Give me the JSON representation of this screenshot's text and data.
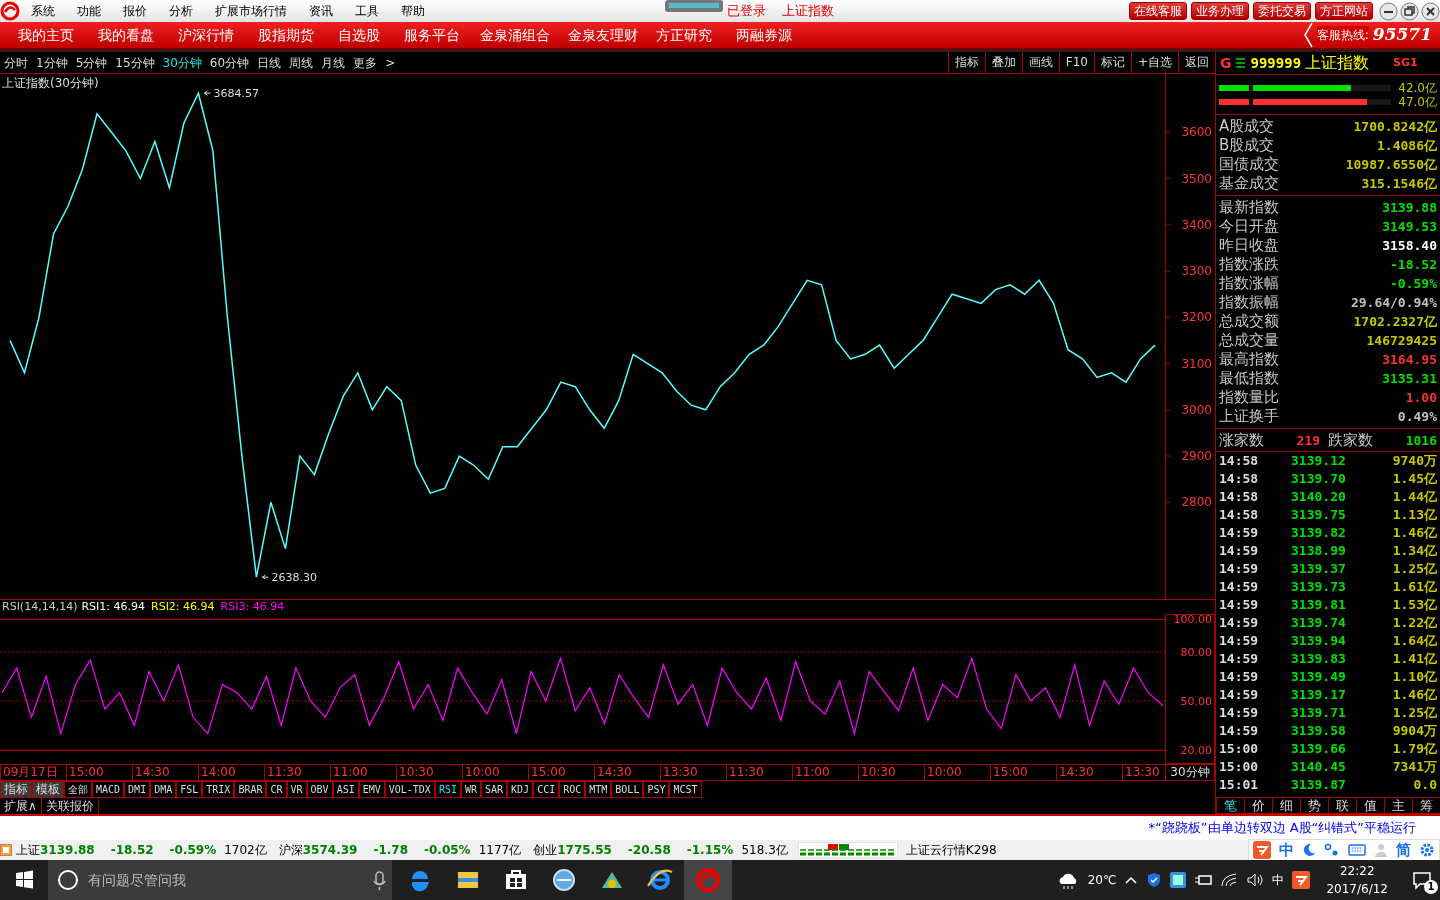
{
  "title_bar": {
    "menu": [
      "系统",
      "功能",
      "报价",
      "分析",
      "扩展市场行情",
      "资讯",
      "工具",
      "帮助"
    ],
    "login_status": "已登录",
    "security": "上证指数",
    "buttons": [
      "在线客服",
      "业务办理",
      "委托交易",
      "方正网站"
    ]
  },
  "nav": {
    "items": [
      "我的主页",
      "我的看盘",
      "沪深行情",
      "股指期货",
      "自选股",
      "服务平台",
      "金泉涌组合",
      "金泉友理财",
      "方正研究",
      "两融券源"
    ],
    "hotline_label": "客服热线:",
    "hotline": "95571"
  },
  "periods": [
    {
      "label": "分时",
      "selected": false
    },
    {
      "label": "1分钟",
      "selected": false
    },
    {
      "label": "5分钟",
      "selected": false
    },
    {
      "label": "15分钟",
      "selected": false
    },
    {
      "label": "30分钟",
      "selected": true
    },
    {
      "label": "60分钟",
      "selected": false
    },
    {
      "label": "日线",
      "selected": false
    },
    {
      "label": "周线",
      "selected": false
    },
    {
      "label": "月线",
      "selected": false
    }
  ],
  "more": "更多",
  "more_arrow": ">",
  "tools": [
    "指标",
    "叠加",
    "画线",
    "F10",
    "标记",
    "+自选",
    "返回"
  ],
  "chart_title": "上证指数(30分钟)",
  "price_chart": {
    "chart_data": {
      "type": "line",
      "ylim": [
        2591,
        3726
      ],
      "yticks": [
        2800,
        2900,
        3000,
        3100,
        3200,
        3300,
        3400,
        3500,
        3600
      ],
      "series": [
        {
          "color": "#54ffff",
          "values": [
            3150,
            3080,
            3200,
            3380,
            3440,
            3520,
            3640,
            3600,
            3560,
            3500,
            3580,
            3480,
            3620,
            3684.57,
            3560,
            3200,
            2900,
            2638.3,
            2800,
            2700,
            2900,
            2860,
            2950,
            3030,
            3080,
            3000,
            3050,
            3020,
            2880,
            2820,
            2830,
            2900,
            2880,
            2850,
            2920,
            2920,
            2960,
            3000,
            3060,
            3050,
            3000,
            2960,
            3020,
            3120,
            3100,
            3080,
            3040,
            3010,
            3000,
            3050,
            3080,
            3120,
            3140,
            3180,
            3230,
            3280,
            3270,
            3150,
            3110,
            3120,
            3140,
            3090,
            3120,
            3150,
            3200,
            3250,
            3240,
            3230,
            3260,
            3270,
            3250,
            3280,
            3230,
            3130,
            3110,
            3070,
            3080,
            3060,
            3110,
            3139.88
          ]
        }
      ],
      "annotations": [
        {
          "text": "3684.57"
        },
        {
          "text": "2638.30"
        }
      ]
    }
  },
  "rsi": {
    "label": "RSI(14,14,14)",
    "lines": [
      {
        "label": "RSI1: 46.94",
        "color": "#ffffff"
      },
      {
        "label": "RSI2: 46.94",
        "color": "#ffff00"
      },
      {
        "label": "RSI3: 46.94",
        "color": "#ff00ff"
      }
    ],
    "chart_data": {
      "type": "line",
      "grid": true,
      "ylim": [
        20,
        100
      ],
      "yticks": [
        {
          "value": 20,
          "label": "20.00"
        },
        {
          "value": 50,
          "label": "50.00"
        },
        {
          "value": 80,
          "label": "80.00"
        },
        {
          "value": 100,
          "label": "100.00"
        }
      ],
      "series": [
        {
          "color": "#ff00ff",
          "values": [
            55,
            70,
            40,
            65,
            30,
            60,
            75,
            45,
            55,
            35,
            68,
            50,
            72,
            40,
            30,
            60,
            55,
            45,
            65,
            35,
            70,
            50,
            40,
            58,
            66,
            35,
            52,
            74,
            45,
            60,
            38,
            70,
            55,
            42,
            63,
            30,
            68,
            50,
            76,
            44,
            58,
            36,
            66,
            52,
            40,
            72,
            48,
            60,
            35,
            70,
            55,
            45,
            64,
            38,
            74,
            50,
            42,
            62,
            30,
            68,
            56,
            44,
            70,
            38,
            60,
            52,
            76,
            45,
            33,
            66,
            50,
            58,
            40,
            72,
            35,
            62,
            48,
            70,
            55,
            47
          ]
        }
      ]
    }
  },
  "time_axis": [
    "09月17日",
    "15:00",
    "14:30",
    "14:00",
    "11:30",
    "11:00",
    "10:30",
    "10:00",
    "15:00",
    "14:30",
    "13:30",
    "11:30",
    "11:00",
    "10:30",
    "10:00",
    "15:00",
    "14:30",
    "13:30"
  ],
  "period_label": "30分钟",
  "indicator_tabs": [
    {
      "label": "指标",
      "kind": "menu",
      "selected": false
    },
    {
      "label": "模板",
      "kind": "menu",
      "selected": false
    },
    {
      "label": "全部",
      "kind": "indicator",
      "selected": false
    },
    {
      "label": "MACD",
      "kind": "indicator",
      "selected": false
    },
    {
      "label": "DMI",
      "kind": "indicator",
      "selected": false
    },
    {
      "label": "DMA",
      "kind": "indicator",
      "selected": false
    },
    {
      "label": "FSL",
      "kind": "indicator",
      "selected": false
    },
    {
      "label": "TRIX",
      "kind": "indicator",
      "selected": false
    },
    {
      "label": "BRAR",
      "kind": "indicator",
      "selected": false
    },
    {
      "label": "CR",
      "kind": "indicator",
      "selected": false
    },
    {
      "label": "VR",
      "kind": "indicator",
      "selected": false
    },
    {
      "label": "OBV",
      "kind": "indicator",
      "selected": false
    },
    {
      "label": "ASI",
      "kind": "indicator",
      "selected": false
    },
    {
      "label": "EMV",
      "kind": "indicator",
      "selected": false
    },
    {
      "label": "VOL-TDX",
      "kind": "indicator",
      "selected": false
    },
    {
      "label": "RSI",
      "kind": "indicator",
      "selected": true
    },
    {
      "label": "WR",
      "kind": "indicator",
      "selected": false
    },
    {
      "label": "SAR",
      "kind": "indicator",
      "selected": false
    },
    {
      "label": "KDJ",
      "kind": "indicator",
      "selected": false
    },
    {
      "label": "CCI",
      "kind": "indicator",
      "selected": false
    },
    {
      "label": "ROC",
      "kind": "indicator",
      "selected": false
    },
    {
      "label": "MTM",
      "kind": "indicator",
      "selected": false
    },
    {
      "label": "BOLL",
      "kind": "indicator",
      "selected": false
    },
    {
      "label": "PSY",
      "kind": "indicator",
      "selected": false
    },
    {
      "label": "MCST",
      "kind": "indicator",
      "selected": false
    }
  ],
  "extra_tabs": [
    "扩展∧",
    "关联报价"
  ],
  "quote_panel": {
    "mark": "G",
    "code": "999999",
    "name": "上证指数",
    "flag": "SG1",
    "bars": [
      {
        "level": 0.77,
        "reading": "42.0亿",
        "color": "#00e000"
      },
      {
        "level": 0.86,
        "reading": "47.0亿",
        "color": "#ff3030"
      }
    ],
    "turnover": [
      {
        "label": "A股成交",
        "value": "1700.8242亿"
      },
      {
        "label": "B股成交",
        "value": "1.4086亿"
      },
      {
        "label": "国债成交",
        "value": "10987.6550亿"
      },
      {
        "label": "基金成交",
        "value": "315.1546亿"
      }
    ],
    "stats": [
      {
        "label": "最新指数",
        "value": "3139.88",
        "color": "#00e000"
      },
      {
        "label": "今日开盘",
        "value": "3149.53",
        "color": "#00e000"
      },
      {
        "label": "昨日收盘",
        "value": "3158.40",
        "color": "#ffffff"
      },
      {
        "label": "指数涨跌",
        "value": "-18.52",
        "color": "#00e000"
      },
      {
        "label": "指数涨幅",
        "value": "-0.59%",
        "color": "#00e000"
      },
      {
        "label": "指数振幅",
        "value": "29.64/0.94%",
        "color": "#c0c0c0"
      },
      {
        "label": "总成交额",
        "value": "1702.2327亿",
        "color": "#c8c800"
      },
      {
        "label": "总成交量",
        "value": "146729425",
        "color": "#c8c800"
      },
      {
        "label": "最高指数",
        "value": "3164.95",
        "color": "#ff3030"
      },
      {
        "label": "最低指数",
        "value": "3135.31",
        "color": "#00e000"
      },
      {
        "label": "指数量比",
        "value": "1.00",
        "color": "#ff3030"
      },
      {
        "label": "上证换手",
        "value": "0.49%",
        "color": "#c0c0c0"
      }
    ],
    "breadth": {
      "up_label": "涨家数",
      "up": "219",
      "down_label": "跌家数",
      "down": "1016"
    },
    "ticks": [
      {
        "time": "14:58",
        "price": "3139.12",
        "volume": "9740万"
      },
      {
        "time": "14:58",
        "price": "3139.70",
        "volume": "1.45亿"
      },
      {
        "time": "14:58",
        "price": "3140.20",
        "volume": "1.44亿"
      },
      {
        "time": "14:58",
        "price": "3139.75",
        "volume": "1.13亿"
      },
      {
        "time": "14:59",
        "price": "3139.82",
        "volume": "1.46亿"
      },
      {
        "time": "14:59",
        "price": "3138.99",
        "volume": "1.34亿"
      },
      {
        "time": "14:59",
        "price": "3139.37",
        "volume": "1.25亿"
      },
      {
        "time": "14:59",
        "price": "3139.73",
        "volume": "1.61亿"
      },
      {
        "time": "14:59",
        "price": "3139.81",
        "volume": "1.53亿"
      },
      {
        "time": "14:59",
        "price": "3139.74",
        "volume": "1.22亿"
      },
      {
        "time": "14:59",
        "price": "3139.94",
        "volume": "1.64亿"
      },
      {
        "time": "14:59",
        "price": "3139.83",
        "volume": "1.41亿"
      },
      {
        "time": "14:59",
        "price": "3139.49",
        "volume": "1.10亿"
      },
      {
        "time": "14:59",
        "price": "3139.17",
        "volume": "1.46亿"
      },
      {
        "time": "14:59",
        "price": "3139.71",
        "volume": "1.25亿"
      },
      {
        "time": "14:59",
        "price": "3139.58",
        "volume": "9904万"
      },
      {
        "time": "15:00",
        "price": "3139.66",
        "volume": "1.79亿"
      },
      {
        "time": "15:00",
        "price": "3140.45",
        "volume": "7341万"
      },
      {
        "time": "15:01",
        "price": "3139.87",
        "volume": "0.0"
      }
    ],
    "tabs": [
      {
        "label": "笔",
        "selected": true
      },
      {
        "label": "价",
        "selected": false
      },
      {
        "label": "细",
        "selected": false
      },
      {
        "label": "势",
        "selected": false
      },
      {
        "label": "联",
        "selected": false
      },
      {
        "label": "值",
        "selected": false
      },
      {
        "label": "主",
        "selected": false
      },
      {
        "label": "筹",
        "selected": false
      }
    ]
  },
  "news": "*“跷跷板”由单边转双边 A股“纠错式”平稳运行",
  "status_bar": {
    "indices": [
      {
        "name": "上证",
        "value": "3139.88",
        "change": "-18.52",
        "pct": "-0.59%",
        "amount": "1702亿"
      },
      {
        "name": "沪深",
        "value": "3574.39",
        "change": "-1.78",
        "pct": "-0.05%",
        "amount": "1177亿"
      },
      {
        "name": "创业",
        "value": "1775.55",
        "change": "-20.58",
        "pct": "-1.15%",
        "amount": "518.3亿"
      }
    ],
    "cloud": "上证云行情K298"
  },
  "ime_bar": [
    "中",
    "简"
  ],
  "taskbar": {
    "search_placeholder": "有问题尽管问我",
    "weather": "20℃",
    "ime": "中",
    "time": "22:22",
    "date": "2017/6/12",
    "notifications": "1"
  }
}
